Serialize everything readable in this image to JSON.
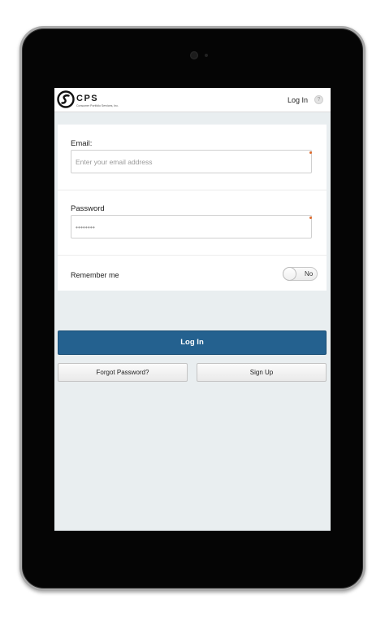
{
  "app": {
    "logo_text": "CPS",
    "logo_subtitle": "Consumer Portfolio Services, Inc.",
    "header_login_label": "Log In",
    "help_label": "?"
  },
  "form": {
    "email": {
      "label": "Email:",
      "value": "",
      "placeholder": "Enter your email address"
    },
    "password": {
      "label": "Password",
      "value": "",
      "placeholder": "••••••••"
    },
    "remember": {
      "label": "Remember me",
      "state": "No"
    }
  },
  "actions": {
    "login_label": "Log In",
    "forgot_label": "Forgot Password?",
    "signup_label": "Sign Up"
  },
  "colors": {
    "primary": "#24618f",
    "background": "#e9eef0",
    "required": "#e06a2a",
    "bezel": "#050505"
  },
  "icons": {
    "logo": "cps-logo-icon",
    "help": "help-icon",
    "camera": "camera-icon"
  }
}
